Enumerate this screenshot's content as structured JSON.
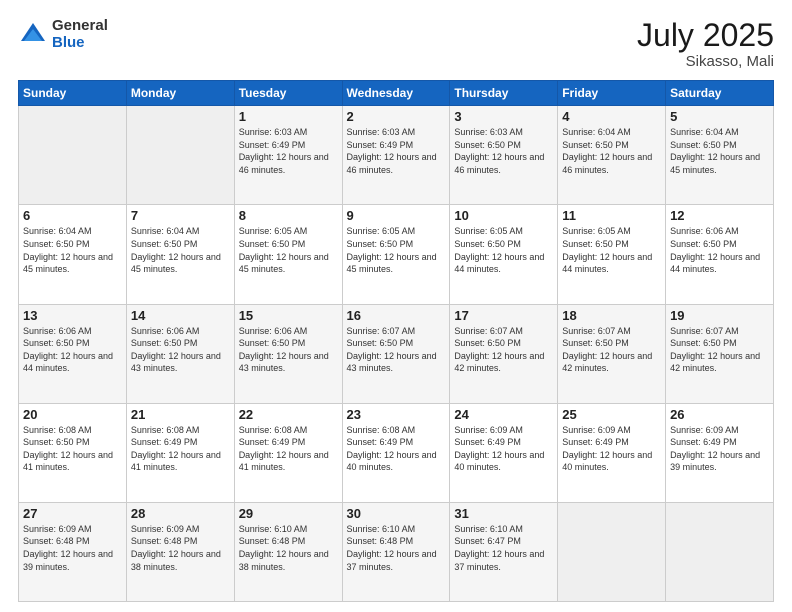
{
  "header": {
    "logo_general": "General",
    "logo_blue": "Blue",
    "title": "July 2025",
    "subtitle": "Sikasso, Mali"
  },
  "weekdays": [
    "Sunday",
    "Monday",
    "Tuesday",
    "Wednesday",
    "Thursday",
    "Friday",
    "Saturday"
  ],
  "weeks": [
    [
      {
        "day": "",
        "info": ""
      },
      {
        "day": "",
        "info": ""
      },
      {
        "day": "1",
        "info": "Sunrise: 6:03 AM\nSunset: 6:49 PM\nDaylight: 12 hours and 46 minutes."
      },
      {
        "day": "2",
        "info": "Sunrise: 6:03 AM\nSunset: 6:49 PM\nDaylight: 12 hours and 46 minutes."
      },
      {
        "day": "3",
        "info": "Sunrise: 6:03 AM\nSunset: 6:50 PM\nDaylight: 12 hours and 46 minutes."
      },
      {
        "day": "4",
        "info": "Sunrise: 6:04 AM\nSunset: 6:50 PM\nDaylight: 12 hours and 46 minutes."
      },
      {
        "day": "5",
        "info": "Sunrise: 6:04 AM\nSunset: 6:50 PM\nDaylight: 12 hours and 45 minutes."
      }
    ],
    [
      {
        "day": "6",
        "info": "Sunrise: 6:04 AM\nSunset: 6:50 PM\nDaylight: 12 hours and 45 minutes."
      },
      {
        "day": "7",
        "info": "Sunrise: 6:04 AM\nSunset: 6:50 PM\nDaylight: 12 hours and 45 minutes."
      },
      {
        "day": "8",
        "info": "Sunrise: 6:05 AM\nSunset: 6:50 PM\nDaylight: 12 hours and 45 minutes."
      },
      {
        "day": "9",
        "info": "Sunrise: 6:05 AM\nSunset: 6:50 PM\nDaylight: 12 hours and 45 minutes."
      },
      {
        "day": "10",
        "info": "Sunrise: 6:05 AM\nSunset: 6:50 PM\nDaylight: 12 hours and 44 minutes."
      },
      {
        "day": "11",
        "info": "Sunrise: 6:05 AM\nSunset: 6:50 PM\nDaylight: 12 hours and 44 minutes."
      },
      {
        "day": "12",
        "info": "Sunrise: 6:06 AM\nSunset: 6:50 PM\nDaylight: 12 hours and 44 minutes."
      }
    ],
    [
      {
        "day": "13",
        "info": "Sunrise: 6:06 AM\nSunset: 6:50 PM\nDaylight: 12 hours and 44 minutes."
      },
      {
        "day": "14",
        "info": "Sunrise: 6:06 AM\nSunset: 6:50 PM\nDaylight: 12 hours and 43 minutes."
      },
      {
        "day": "15",
        "info": "Sunrise: 6:06 AM\nSunset: 6:50 PM\nDaylight: 12 hours and 43 minutes."
      },
      {
        "day": "16",
        "info": "Sunrise: 6:07 AM\nSunset: 6:50 PM\nDaylight: 12 hours and 43 minutes."
      },
      {
        "day": "17",
        "info": "Sunrise: 6:07 AM\nSunset: 6:50 PM\nDaylight: 12 hours and 42 minutes."
      },
      {
        "day": "18",
        "info": "Sunrise: 6:07 AM\nSunset: 6:50 PM\nDaylight: 12 hours and 42 minutes."
      },
      {
        "day": "19",
        "info": "Sunrise: 6:07 AM\nSunset: 6:50 PM\nDaylight: 12 hours and 42 minutes."
      }
    ],
    [
      {
        "day": "20",
        "info": "Sunrise: 6:08 AM\nSunset: 6:50 PM\nDaylight: 12 hours and 41 minutes."
      },
      {
        "day": "21",
        "info": "Sunrise: 6:08 AM\nSunset: 6:49 PM\nDaylight: 12 hours and 41 minutes."
      },
      {
        "day": "22",
        "info": "Sunrise: 6:08 AM\nSunset: 6:49 PM\nDaylight: 12 hours and 41 minutes."
      },
      {
        "day": "23",
        "info": "Sunrise: 6:08 AM\nSunset: 6:49 PM\nDaylight: 12 hours and 40 minutes."
      },
      {
        "day": "24",
        "info": "Sunrise: 6:09 AM\nSunset: 6:49 PM\nDaylight: 12 hours and 40 minutes."
      },
      {
        "day": "25",
        "info": "Sunrise: 6:09 AM\nSunset: 6:49 PM\nDaylight: 12 hours and 40 minutes."
      },
      {
        "day": "26",
        "info": "Sunrise: 6:09 AM\nSunset: 6:49 PM\nDaylight: 12 hours and 39 minutes."
      }
    ],
    [
      {
        "day": "27",
        "info": "Sunrise: 6:09 AM\nSunset: 6:48 PM\nDaylight: 12 hours and 39 minutes."
      },
      {
        "day": "28",
        "info": "Sunrise: 6:09 AM\nSunset: 6:48 PM\nDaylight: 12 hours and 38 minutes."
      },
      {
        "day": "29",
        "info": "Sunrise: 6:10 AM\nSunset: 6:48 PM\nDaylight: 12 hours and 38 minutes."
      },
      {
        "day": "30",
        "info": "Sunrise: 6:10 AM\nSunset: 6:48 PM\nDaylight: 12 hours and 37 minutes."
      },
      {
        "day": "31",
        "info": "Sunrise: 6:10 AM\nSunset: 6:47 PM\nDaylight: 12 hours and 37 minutes."
      },
      {
        "day": "",
        "info": ""
      },
      {
        "day": "",
        "info": ""
      }
    ]
  ]
}
